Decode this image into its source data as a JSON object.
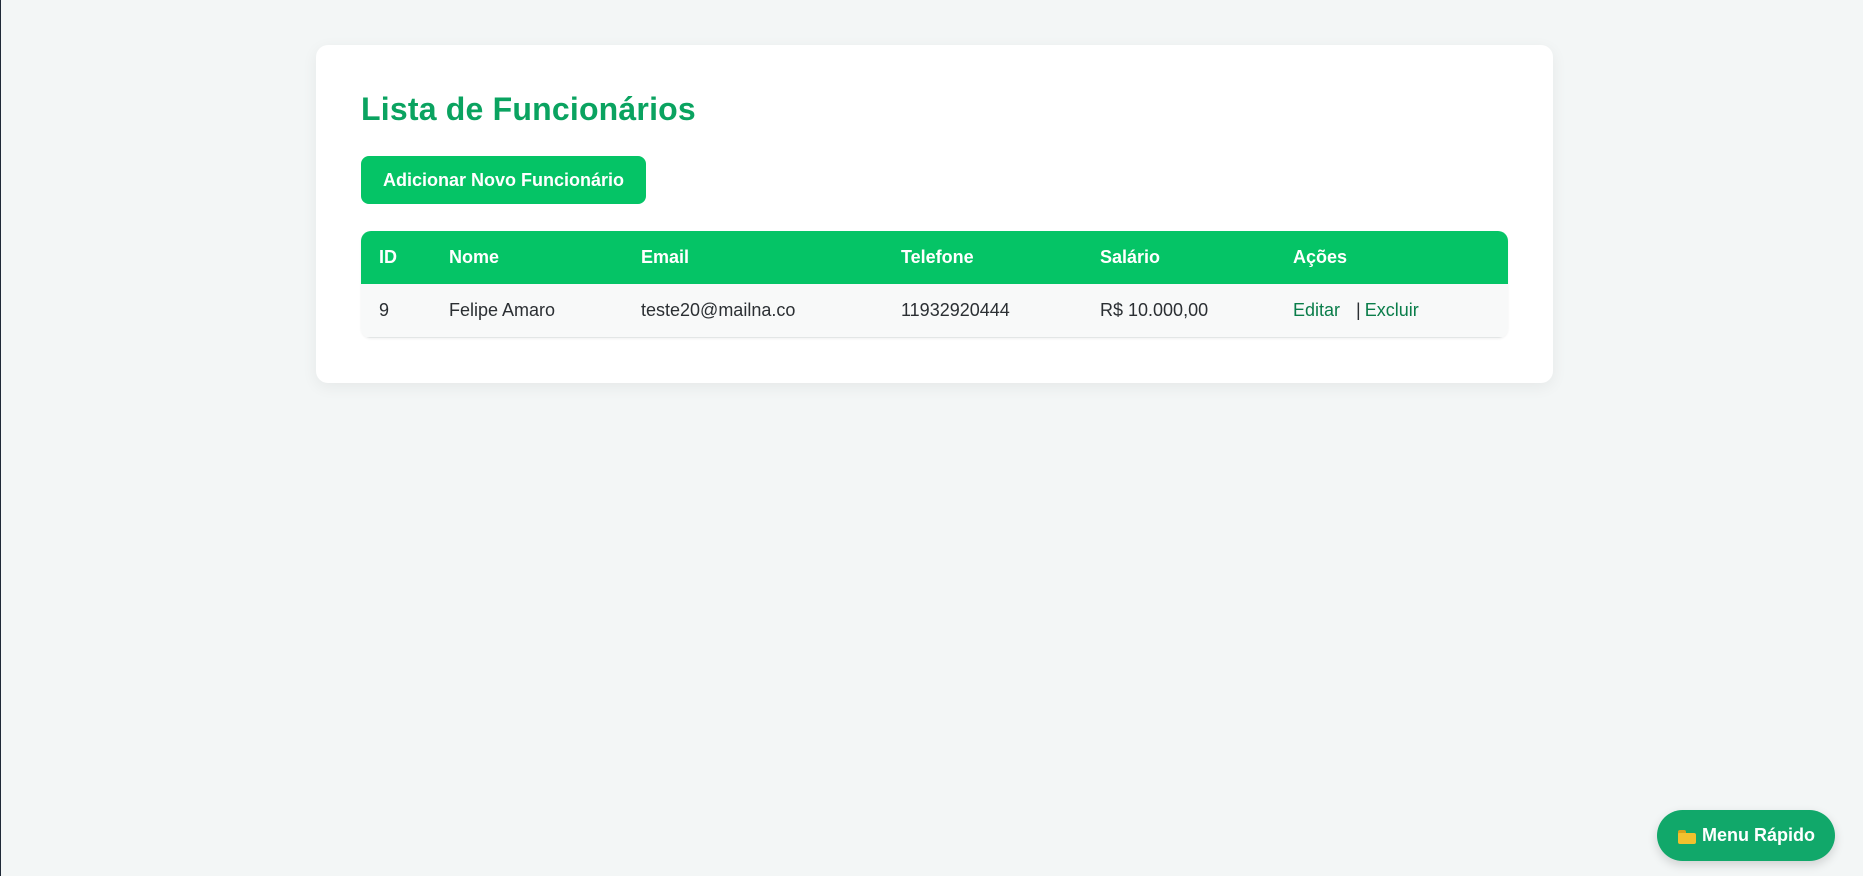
{
  "page": {
    "title": "Lista de Funcionários",
    "add_button_label": "Adicionar Novo Funcionário"
  },
  "table": {
    "headers": {
      "id": "ID",
      "nome": "Nome",
      "email": "Email",
      "telefone": "Telefone",
      "salario": "Salário",
      "acoes": "Ações"
    },
    "rows": [
      {
        "id": "9",
        "nome": "Felipe Amaro",
        "email": "teste20@mailna.co",
        "telefone": "11932920444",
        "salario": "R$ 10.000,00",
        "edit_label": "Editar",
        "separator": "|",
        "delete_label": "Excluir"
      }
    ]
  },
  "quick_menu": {
    "label": "Menu Rápido",
    "icon": "folder-icon"
  },
  "colors": {
    "accent": "#05c466",
    "title": "#0aa360",
    "link": "#0a7d4a",
    "background": "#f3f6f6"
  }
}
